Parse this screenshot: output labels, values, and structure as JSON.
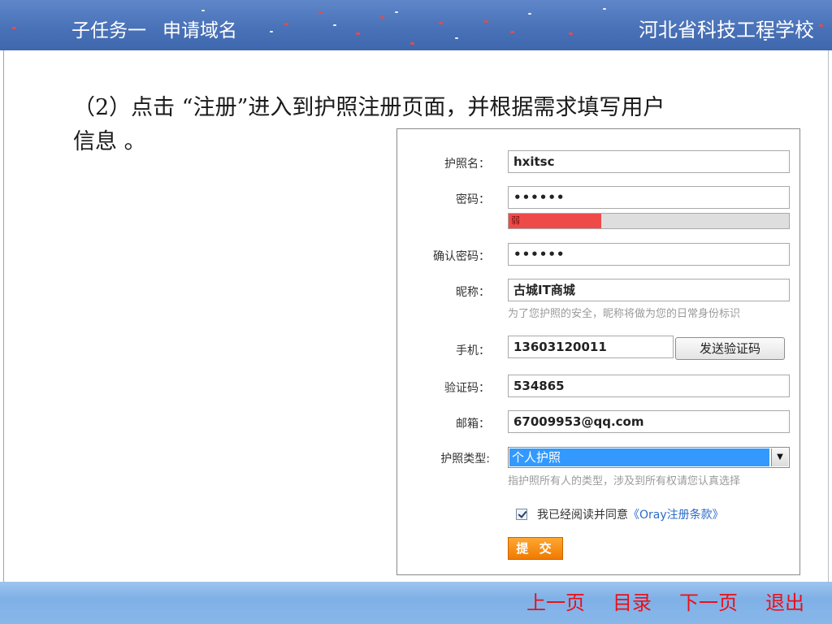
{
  "header": {
    "task": "子任务一",
    "subtask": "申请域名",
    "school": "河北省科技工程学校"
  },
  "content": {
    "step_line1": "（2）点击 “注册”进入到护照注册页面，并根据需求填写用户",
    "step_line2": "信息 。"
  },
  "form": {
    "passport_name_label": "护照名：",
    "passport_name_value": "hxitsc",
    "password_label": "密码：",
    "password_value": "••••••",
    "strength_label": "弱",
    "strength_level": 0.33,
    "confirm_label": "确认密码：",
    "confirm_value": "••••••",
    "nickname_label": "昵称：",
    "nickname_value": "古城IT商城",
    "nickname_hint": "为了您护照的安全，昵称将做为您的日常身份标识",
    "phone_label": "手机：",
    "phone_value": "13603120011",
    "send_code_button": "发送验证码",
    "code_label": "验证码：",
    "code_value": "534865",
    "email_label": "邮箱：",
    "email_value": "67009953@qq.com",
    "type_label": "护照类型:",
    "type_value": "个人护照",
    "type_hint": "指护照所有人的类型，涉及到所有权请您认真选择",
    "agree_text": "我已经阅读并同意",
    "terms_link": "《Oray注册条款》",
    "submit_button": "提 交"
  },
  "footer": {
    "prev": "上一页",
    "toc": "目录",
    "next": "下一页",
    "exit": "退出"
  },
  "colors": {
    "header_bg": "#4a72b8",
    "footer_bg": "#8fbbea",
    "nav_text": "#e8101a",
    "select_highlight": "#3399ff",
    "submit_bg": "#f28a10",
    "strength_weak": "#ef4a4a"
  }
}
